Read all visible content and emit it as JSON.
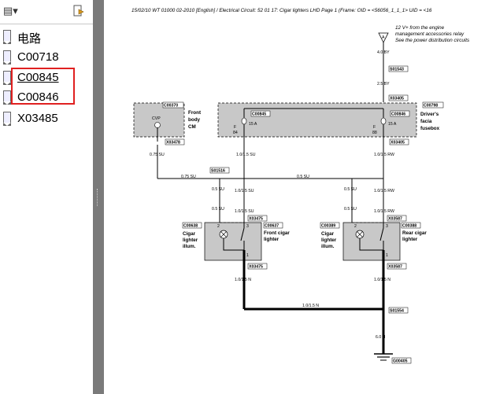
{
  "sidebar": {
    "toolbar": {
      "menu_icon": "grid-menu-icon",
      "options_icon": "bookmark-options-icon"
    },
    "bookmarks": [
      {
        "label": "电路"
      },
      {
        "label": "C00718"
      },
      {
        "label": "C00845"
      },
      {
        "label": "C00846"
      },
      {
        "label": "X03485"
      }
    ]
  },
  "document": {
    "header": "15/02/10  WT 01000 02-2010 [English] / Electrical Circuit: 52 01 17: Cigar lighters LHD  Page 1  (Frame: OID = <56056_1_1_1>  UID = <16",
    "note": [
      "12 V+ from the engine",
      "management accessories relay",
      "See the power distribution circuits"
    ],
    "wire_labels": {
      "w1": "4.0 BY",
      "w2": "2.5 BY",
      "w3": "0.75 SU",
      "w4": "0.75 SU",
      "w5": "0.5 SU",
      "w6": "1.0/1.5 SU",
      "w7": "1.0/1.5 RW",
      "w8": "0.5 SU",
      "w9": "1.0/1.5 SU",
      "w10": "0.5 SU",
      "w11": "1.0/1.5 RW",
      "w12": "0.5 SU",
      "w13": "1.0/1.5 RW",
      "w14": "1.0/1.5 N",
      "w15": "1.0/1.5 N",
      "w16": "1.0/1.5 N",
      "w17": "6.0 N"
    },
    "connectors": {
      "s01543": "S01543",
      "x03405a": "X03405",
      "c00370": "C00370",
      "c00798": "C00798",
      "c00845": "C00845",
      "c00846": "C00846",
      "x03478": "X03478",
      "x03405b": "X03405",
      "s01516": "S01516",
      "x03475a": "X03475",
      "c00637": "C00637",
      "c00638": "C00638",
      "x03587a": "X03587",
      "c00388": "C00388",
      "c00389": "C00389",
      "x03475b": "X03475",
      "x03587b": "X03587",
      "s01554": "S01554",
      "g00405": "G00405"
    },
    "components": {
      "front_body": [
        "Front",
        "body",
        "CM"
      ],
      "drivers_facia": [
        "Driver's",
        "facia",
        "fusebox"
      ],
      "front_cigar": [
        "Front cigar",
        "lighter"
      ],
      "rear_cigar": [
        "Rear cigar",
        "lighter"
      ],
      "cigar_illum_left": [
        "Cigar",
        "lighter",
        "illum."
      ],
      "cigar_illum_right": [
        "Cigar",
        "lighter",
        "illum."
      ]
    },
    "fuse_labels": {
      "cvp": "CVP",
      "f84": "F",
      "f84n": "84",
      "fuse15a_1": "15 A",
      "f88": "F",
      "f88n": "88",
      "fuse15a_2": "15 A",
      "f_left": "F",
      "f_leftn": "8"
    },
    "pins": {
      "p2a": "2",
      "p3a": "3",
      "p1a": "1",
      "p2b": "2",
      "p3b": "3",
      "p1b": "1",
      "a": "A"
    }
  }
}
